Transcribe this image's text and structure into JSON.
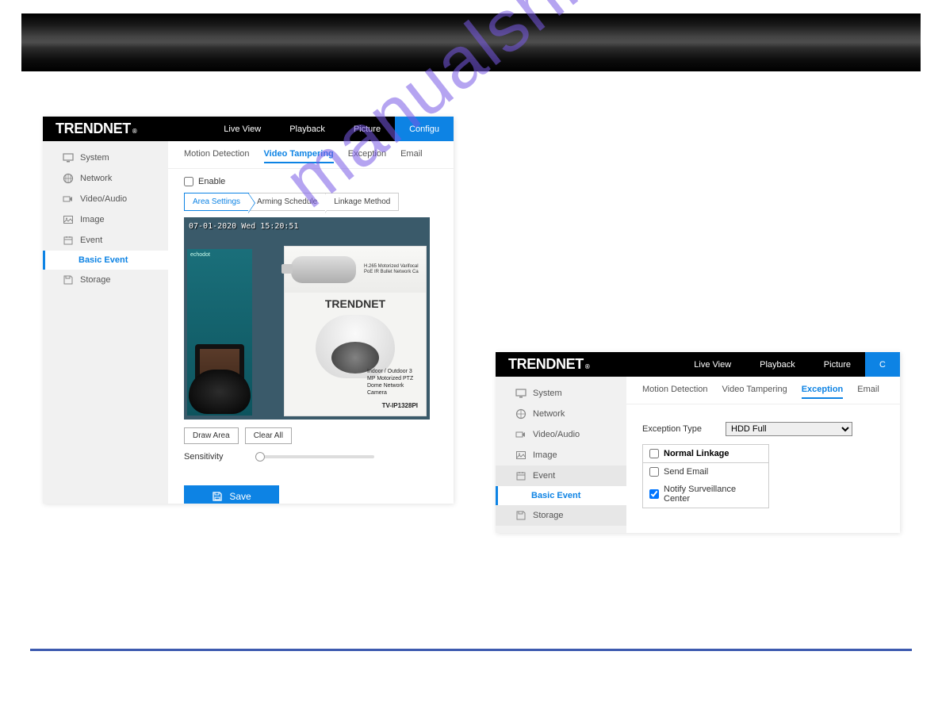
{
  "watermark": "manualshive.com",
  "brand": "TRENDNET",
  "regmark": "®",
  "panel1": {
    "nav": {
      "live": "Live View",
      "playback": "Playback",
      "picture": "Picture",
      "config": "Configu"
    },
    "sidebar": {
      "system": "System",
      "network": "Network",
      "videoaudio": "Video/Audio",
      "image": "Image",
      "event": "Event",
      "basic_event": "Basic Event",
      "storage": "Storage"
    },
    "subtabs": {
      "motion": "Motion Detection",
      "tamper": "Video Tampering",
      "exception": "Exception",
      "email": "Email"
    },
    "enable_label": "Enable",
    "segtabs": {
      "area": "Area Settings",
      "arming": "Arming Schedule",
      "linkage": "Linkage Method"
    },
    "video": {
      "timestamp": "07-01-2020 Wed 15:20:51",
      "box_top_text": "H.265 Motorized Varifocal PoE IR Bullet Network Ca",
      "box_brand": "TRENDNET",
      "box_desc": "Indoor / Outdoor 3 MP Motorized PTZ Dome Network Camera",
      "box_model": "TV-IP1328PI",
      "teal_word": "echodot"
    },
    "buttons": {
      "draw": "Draw Area",
      "clear": "Clear All"
    },
    "sensitivity_label": "Sensitivity",
    "save_label": "Save"
  },
  "panel2": {
    "nav": {
      "live": "Live View",
      "playback": "Playback",
      "picture": "Picture",
      "config": "C"
    },
    "sidebar": {
      "system": "System",
      "network": "Network",
      "videoaudio": "Video/Audio",
      "image": "Image",
      "event": "Event",
      "basic_event": "Basic Event",
      "storage": "Storage"
    },
    "subtabs": {
      "motion": "Motion Detection",
      "tamper": "Video Tampering",
      "exception": "Exception",
      "email": "Email"
    },
    "exception_type_label": "Exception Type",
    "exception_type_value": "HDD Full",
    "linkage": {
      "header": "Normal Linkage",
      "send_email": "Send Email",
      "notify": "Notify Surveillance Center"
    }
  }
}
